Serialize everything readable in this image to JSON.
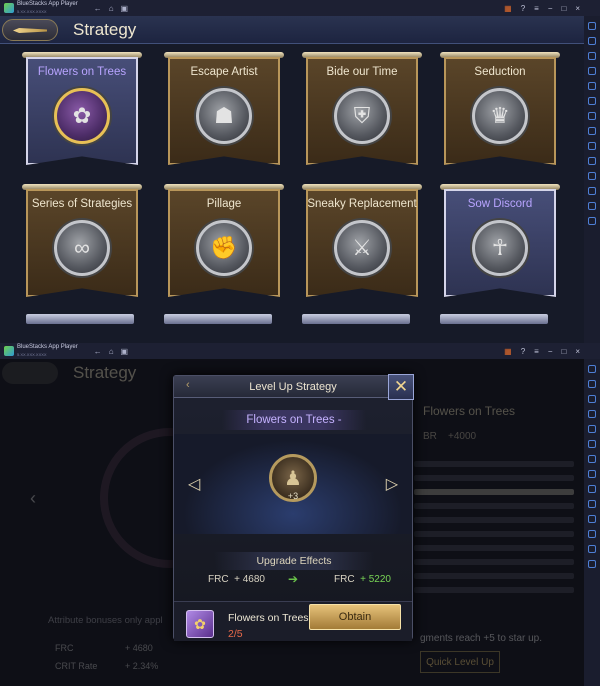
{
  "window": {
    "app_name": "BlueStacks App Player",
    "app_version": "5.XX.XXX.XXXX"
  },
  "top": {
    "title": "Strategy",
    "cards": [
      {
        "label": "Flowers on Trees",
        "selected": true,
        "style": "gold",
        "icon": "plum-blossom-icon"
      },
      {
        "label": "Escape Artist",
        "selected": false,
        "style": "silver",
        "icon": "warrior-portrait-icon"
      },
      {
        "label": "Bide our Time",
        "selected": false,
        "style": "silver",
        "icon": "armored-soldier-icon"
      },
      {
        "label": "Seduction",
        "selected": false,
        "style": "silver",
        "icon": "lady-portrait-icon"
      },
      {
        "label": "Series of Strategies",
        "selected": false,
        "style": "silver",
        "icon": "chain-links-icon"
      },
      {
        "label": "Pillage",
        "selected": false,
        "style": "silver",
        "icon": "fist-icon"
      },
      {
        "label": "Sneaky Replacement",
        "selected": false,
        "style": "silver",
        "icon": "crossed-swords-icon"
      },
      {
        "label": "Sow Discord",
        "selected": true,
        "style": "silver",
        "icon": "hooded-figure-icon"
      }
    ]
  },
  "bottom": {
    "bg_title": "Strategy",
    "bg_info": {
      "name": "Flowers on Trees",
      "stat_label": "BR",
      "stat_value": "+4000"
    },
    "bg_attr_title": "Attribute bonuses only appl",
    "bg_attrs": [
      {
        "label": "FRC",
        "value": "+ 4680"
      },
      {
        "label": "CRIT Rate",
        "value": "+ 2.34%"
      }
    ],
    "bg_fragments": "gments reach +5 to star up.",
    "bg_quick": "Quick Level Up",
    "modal": {
      "title": "Level Up Strategy",
      "name": "Flowers on Trees -",
      "level": "+3",
      "effects_label": "Upgrade Effects",
      "stat_label": "FRC",
      "stat_before": "+ 4680",
      "stat_after": "+ 5220",
      "item_name": "Flowers on Trees",
      "item_count": "2/5",
      "obtain_label": "Obtain"
    }
  },
  "colors": {
    "accent_gold": "#e6c27a",
    "selected_purple": "#b8a4ff",
    "increase_green": "#78d455",
    "insufficient_red": "#e86a4a"
  }
}
